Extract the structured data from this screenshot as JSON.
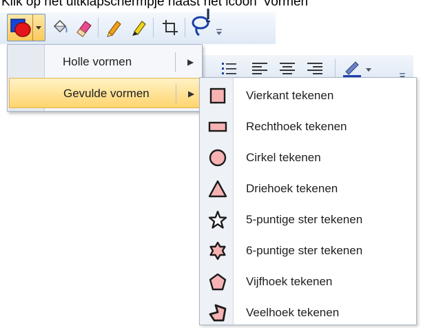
{
  "caption": "Klik op het uitklapschermpje naast het icoon 'Vormen'",
  "menu": {
    "items": [
      {
        "label": "Holle vormen",
        "arrow": "▶"
      },
      {
        "label": "Gevulde vormen",
        "arrow": "▶"
      }
    ]
  },
  "submenu": {
    "items": [
      {
        "label": "Vierkant tekenen",
        "icon": "square-icon"
      },
      {
        "label": "Rechthoek tekenen",
        "icon": "rectangle-icon"
      },
      {
        "label": "Cirkel tekenen",
        "icon": "circle-icon"
      },
      {
        "label": "Driehoek tekenen",
        "icon": "triangle-icon"
      },
      {
        "label": "5-puntige ster tekenen",
        "icon": "five-point-star-icon"
      },
      {
        "label": "6-puntige ster tekenen",
        "icon": "six-point-star-icon"
      },
      {
        "label": "Vijfhoek tekenen",
        "icon": "pentagon-icon"
      },
      {
        "label": "Veelhoek tekenen",
        "icon": "polygon-icon"
      }
    ]
  },
  "colors": {
    "fill_pink": "#f7b3b3",
    "outline": "#1b1b1b",
    "highlight": "#ffd46e"
  }
}
